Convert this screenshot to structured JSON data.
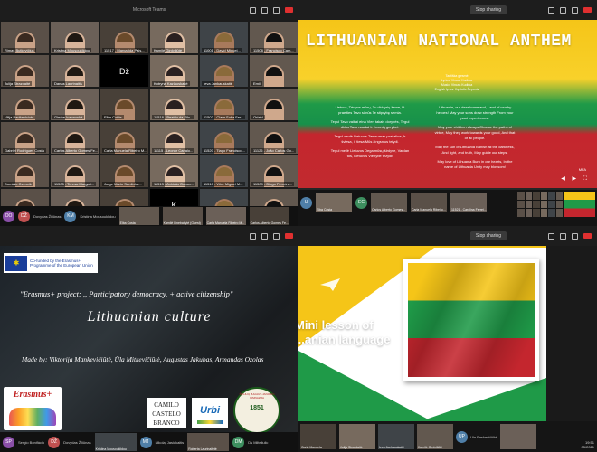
{
  "q1": {
    "window_title": "Microsoft Teams",
    "participants": [
      {
        "name": "Rimas Butkevičius",
        "type": "video"
      },
      {
        "name": "Kristina Mousouklidou",
        "type": "video"
      },
      {
        "name": "11517 - Margarida Pais...",
        "type": "video"
      },
      {
        "name": "Kamilė Girdviliūtė",
        "type": "video"
      },
      {
        "name": "11001 - David Miguel...",
        "type": "video"
      },
      {
        "name": "11508 - Francisco Cam...",
        "type": "video"
      },
      {
        "name": "Julija Strazdaitė",
        "type": "video"
      },
      {
        "name": "Danas Laurinaitis",
        "type": "video"
      },
      {
        "name": "",
        "type": "blank",
        "initial": "Dž"
      },
      {
        "name": "Kotryna Kazlauskaitė",
        "type": "video"
      },
      {
        "name": "Ieva Jankauskaitė",
        "type": "video"
      },
      {
        "name": "Emil",
        "type": "video"
      },
      {
        "name": "Vilija Bartkeviciute",
        "type": "video"
      },
      {
        "name": "Giedre Ivanauskė",
        "type": "video"
      },
      {
        "name": "Elba Cottle",
        "type": "video"
      },
      {
        "name": "11518 - Beatriz da Silv...",
        "type": "video"
      },
      {
        "name": "11502 - Clara Sofia Fer...",
        "type": "video"
      },
      {
        "name": "Orlaid",
        "type": "video"
      },
      {
        "name": "Gabriel Rodrigues Costa",
        "type": "video"
      },
      {
        "name": "Carlos Alberto Gomes Fe...",
        "type": "video"
      },
      {
        "name": "Carla Manuela Ribeiro M...",
        "type": "video"
      },
      {
        "name": "11115 - Leonor Canalo...",
        "type": "video"
      },
      {
        "name": "11520 - Tiago Francisco...",
        "type": "video"
      },
      {
        "name": "11126 - João Carlos Go...",
        "type": "video"
      },
      {
        "name": "Dominic Czerwik",
        "type": "video"
      },
      {
        "name": "11505 - Teresa Margari...",
        "type": "video"
      },
      {
        "name": "Jorge Mário Sardinha...",
        "type": "video"
      },
      {
        "name": "11513 - Antónia Gonza...",
        "type": "video"
      },
      {
        "name": "11510 - Vítor Miguel M...",
        "type": "video"
      },
      {
        "name": "11509 - Diogo Ferreira...",
        "type": "video"
      },
      {
        "name": "Mario Ricardo Araújo Fe...",
        "type": "video"
      },
      {
        "name": "11519 - Ana Catarina...",
        "type": "video"
      },
      {
        "name": "Nicola Paulo Cruz",
        "type": "video"
      },
      {
        "name": "Aleksas Venckus",
        "type": "blank",
        "initial": "K"
      },
      {
        "name": "Ruslanas Borisovas",
        "type": "video"
      },
      {
        "name": "Dovid Gonçalves Teixeira...",
        "type": "video"
      }
    ],
    "strip": [
      {
        "initials": "OO",
        "color": "#8a4fa8",
        "name": ""
      },
      {
        "initials": "DŽ",
        "color": "#c05050",
        "name": "Dovydas Žiliūnas"
      },
      {
        "initials": "KM",
        "color": "#4f7fa8",
        "name": "Kristina Mousouklidou"
      },
      {
        "initials": "",
        "color": "#666",
        "name": "Elba Costa"
      },
      {
        "initials": "",
        "color": "#666",
        "name": "Kamilė Linebaitytė (Guest)"
      },
      {
        "initials": "",
        "color": "#666",
        "name": "Carla Manuela Ribeiro M..."
      },
      {
        "initials": "",
        "color": "#666",
        "name": "Carlos Alberto Gomes Fe..."
      }
    ]
  },
  "q2": {
    "share_label": "Stop sharing",
    "slide": {
      "title": "LITHUANIAN NATIONAL ANTHEM",
      "credits": [
        "Tautiška giesmė",
        "Lyrics: Vincas Kudirka",
        "Music: Vincas Kudirka",
        "English lyrics: Kęstutis Čeponis"
      ],
      "lithuanian": [
        "Lietuva, Tėvyne mūsų, Tu didvyrių žeme, Iš praeities Tavo sūnūs Te stiprybę semia.",
        "Tegul Tavo vaikai eina Vien takais dorybės, Tegul dirba Tavo naudai Ir žmonių gerybei.",
        "Tegul saulė Lietuvos Tamsumas prašalina, Ir šviesa, ir tiesa Mūs žingsnius telydi.",
        "Tegul meilė Lietuvos Dega mūsų širdyse, Vardan tos, Lietuvos Vienybė težydi!"
      ],
      "english": [
        "Lithuania, our dear homeland, Land of worthy heroes! May your sons draw strength From your past experiences.",
        "May your children always Choose the paths of virtue, May they work towards your good, And that of all people.",
        "May the sun of Lithuania Banish all the darkness, And light, and truth, May guide our steps.",
        "May love of Lithuania Burn in our hearts, In the name of Lithuania Unity may blossom!"
      ],
      "page": "MFA"
    },
    "strip": [
      {
        "initials": "U",
        "color": "#4f7fa8",
        "name": ""
      },
      {
        "initials": "",
        "color": "#666",
        "name": "Elba Costa"
      },
      {
        "initials": "EC",
        "color": "#3d8f5f",
        "name": ""
      },
      {
        "initials": "",
        "color": "#666",
        "name": "Carlos Alberto Gomes..."
      },
      {
        "initials": "",
        "color": "#666",
        "name": "Carla Manuela Ribeiro..."
      },
      {
        "initials": "",
        "color": "#666",
        "name": "11521 - Carolina Ferrei..."
      }
    ]
  },
  "q3": {
    "cofund": "Co-funded by the Erasmus+ Programme of the European Union",
    "project_title": "\"Erasmus+ project: ,, Participatory democracy, + active citizenship\"",
    "slide_title": "Lithuanian culture",
    "made_by": "Made by: Viktorija Mankevičiūtė, Ūla Mitkevičiūtė, Augustas Jakubas, Armandas Ozolas",
    "logos": {
      "erasmus": "Erasmus+",
      "camilo": [
        "CAMILO",
        "CASTELO",
        "BRANCO"
      ],
      "urbi": "Urbi",
      "siauliu_year": "1851",
      "siauliu_ring": "ŠIAULIŲ JULIAUS JANONIO GIMNAZIJA",
      "siauliu_motto": "RES NON VERBA"
    },
    "strip": [
      {
        "initials": "SP",
        "color": "#8a4fa8",
        "name": "Sergio Bonifácio"
      },
      {
        "initials": "DŽ",
        "color": "#c05050",
        "name": "Dovydas Žiliūnas"
      },
      {
        "initials": "",
        "color": "#666",
        "name": "Kristina Mousouklidou"
      },
      {
        "initials": "MJ",
        "color": "#4f7fa8",
        "name": "Nikolaj Jasiukaitis"
      },
      {
        "initials": "",
        "color": "#666",
        "name": "Roberta Laurinaitytė"
      },
      {
        "initials": "DM",
        "color": "#3d8f5f",
        "name": "Ds Milteliulic"
      }
    ]
  },
  "q4": {
    "share_label": "Stop sharing",
    "slide": {
      "title_line1": "Mini lesson of",
      "title_line2": "...anian language"
    },
    "strip": [
      {
        "initials": "",
        "color": "#666",
        "name": "Carla Manuela"
      },
      {
        "initials": "",
        "color": "#666",
        "name": "Julija Strazdaitė"
      },
      {
        "initials": "",
        "color": "#666",
        "name": "Ieva Jankauskaitė"
      },
      {
        "initials": "",
        "color": "#666",
        "name": "Kamilė Girdviliūtė"
      },
      {
        "initials": "UP",
        "color": "#4f7fa8",
        "name": "Ula Paskevičiūtė"
      },
      {
        "initials": "",
        "color": "#666",
        "name": ""
      }
    ],
    "clock": [
      "19:51",
      "05/2021"
    ]
  },
  "colors": {
    "lt_yellow": "#f5c518",
    "lt_green": "#1f9a48",
    "lt_red": "#c4262e",
    "eu_blue": "#1a3e9a"
  }
}
